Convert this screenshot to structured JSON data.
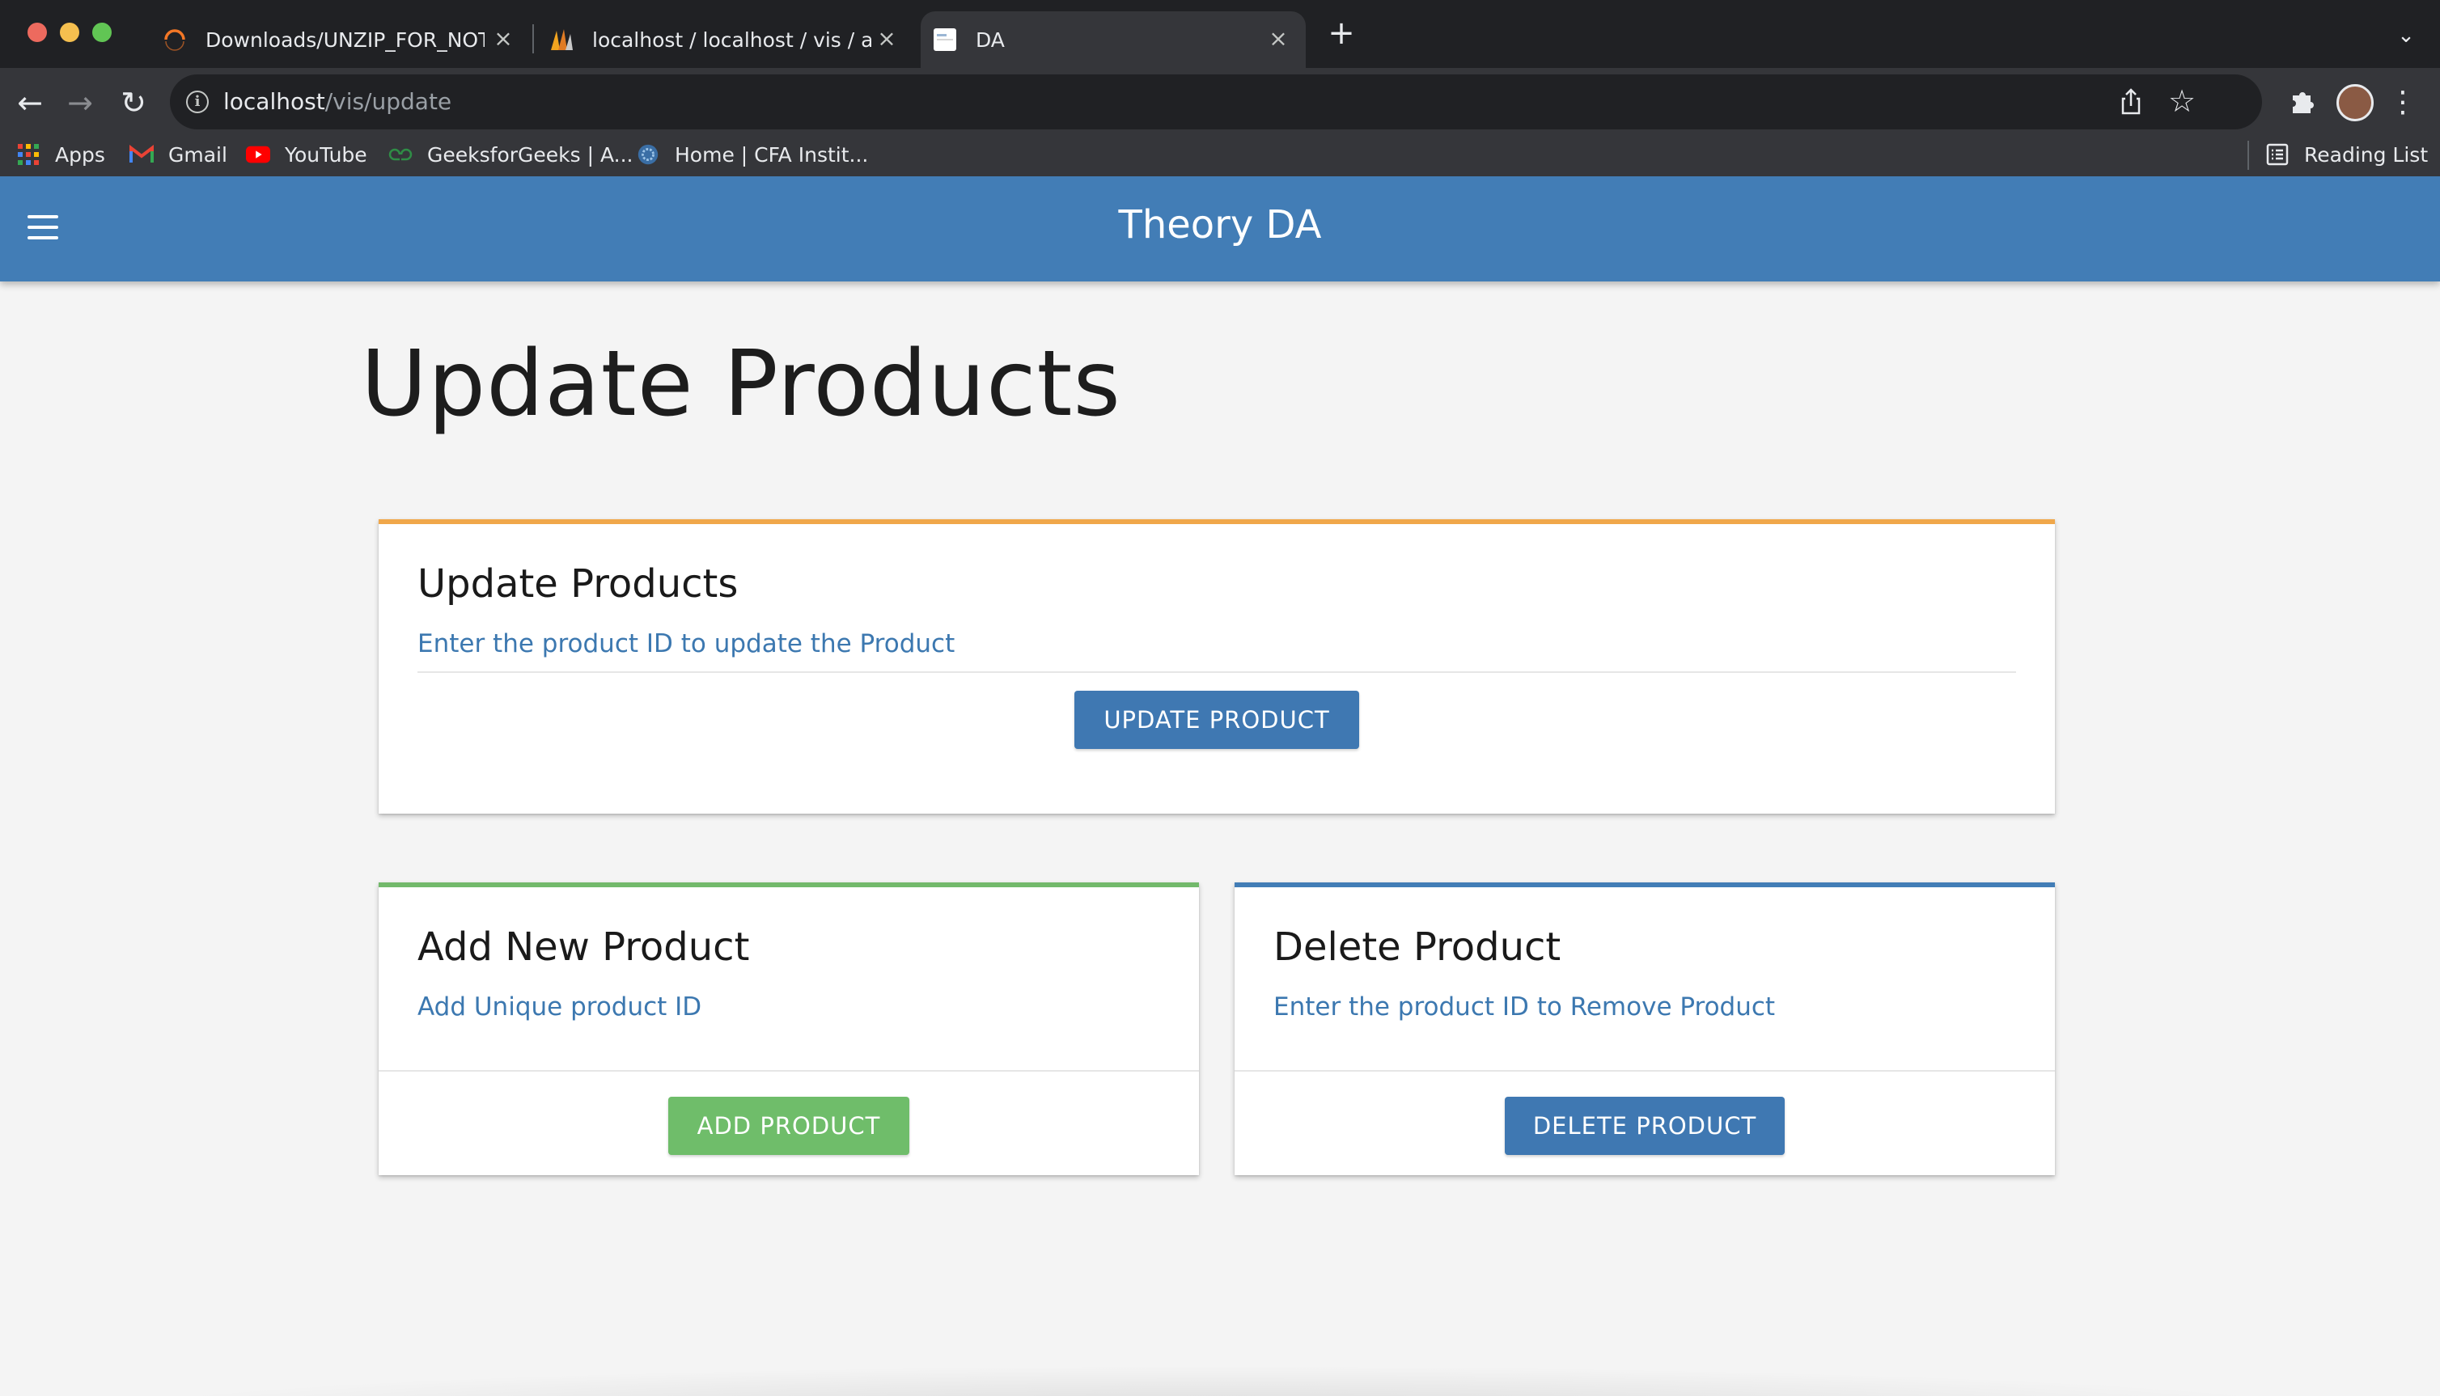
{
  "browser": {
    "tabs": [
      {
        "label": "Downloads/UNZIP_FOR_NOTEBOOKS",
        "icon": "spinner-icon",
        "active": false
      },
      {
        "label": "localhost / localhost / vis / admin",
        "icon": "phpmyadmin-icon",
        "active": false
      },
      {
        "label": "DA",
        "icon": "page-icon",
        "active": true
      }
    ],
    "new_tab_symbol": "+",
    "address_bar": {
      "host": "localhost",
      "path": "/vis/update"
    },
    "bookmarks": [
      {
        "label": "Apps",
        "icon": "apps-grid-icon"
      },
      {
        "label": "Gmail",
        "icon": "gmail-icon"
      },
      {
        "label": "YouTube",
        "icon": "youtube-icon"
      },
      {
        "label": "GeeksforGeeks | A...",
        "icon": "gfg-icon"
      },
      {
        "label": "Home | CFA Instit...",
        "icon": "cfa-icon"
      }
    ],
    "reading_list": {
      "label": "Reading List",
      "icon": "reading-list-icon"
    }
  },
  "app": {
    "title": "Theory DA",
    "colors": {
      "primary": "#427db6",
      "success": "#6fbd6a",
      "warning": "#f0a74a"
    }
  },
  "main": {
    "heading": "Update Products",
    "update_card": {
      "title": "Update Products",
      "subtitle": "Enter the product ID to update the Product",
      "button": "UPDATE PRODUCT"
    },
    "add_card": {
      "title": "Add New Product",
      "subtitle": "Add Unique product ID",
      "button": "ADD PRODUCT"
    },
    "delete_card": {
      "title": "Delete Product",
      "subtitle": "Enter the product ID to Remove Product",
      "button": "DELETE PRODUCT"
    }
  }
}
